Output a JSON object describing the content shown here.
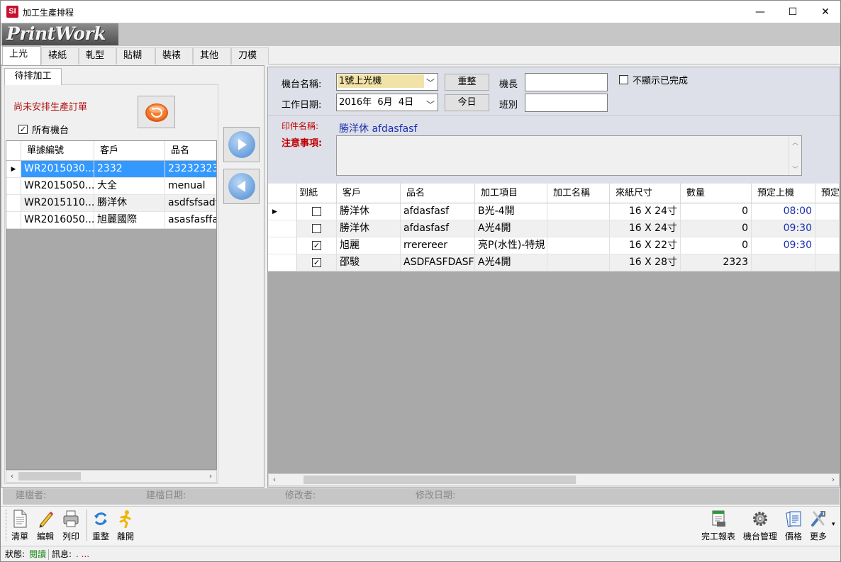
{
  "window": {
    "title": "加工生產排程",
    "app_icon": "SI",
    "minimize": "—",
    "maximize": "☐",
    "close": "✕",
    "logo": "PrintWork"
  },
  "tabs": [
    "上光",
    "裱紙",
    "軋型",
    "貼糊",
    "裝裱",
    "其他",
    "刀模"
  ],
  "left": {
    "subtab": "待排加工",
    "unscheduled_label": "尚未安排生產訂單",
    "all_machines_label": "所有機台",
    "all_machines_checked": true,
    "columns": [
      "單據編號",
      "客戶",
      "品名"
    ],
    "rows": [
      {
        "id": "WR2015030...",
        "customer": "2332",
        "product": "23232323",
        "selected": true
      },
      {
        "id": "WR2015050...",
        "customer": "大全",
        "product": "menual",
        "selected": false
      },
      {
        "id": "WR2015110...",
        "customer": "勝洋休",
        "product": "asdfsfsadf",
        "selected": false
      },
      {
        "id": "WR2016050...",
        "customer": "旭麗國際",
        "product": "asasfasffaf",
        "selected": false
      }
    ]
  },
  "form": {
    "machine_label": "機台名稱:",
    "machine_value": "1號上光機",
    "reset_button": "重整",
    "leader_label": "機長",
    "leader_value": "",
    "hide_done_label": "不顯示已完成",
    "hide_done_checked": false,
    "date_label": "工作日期:",
    "date_value": "2016年  6月  4日",
    "today_button": "今日",
    "shift_label": "班別",
    "shift_value": "",
    "print_name_label": "印件名稱:",
    "print_name_value": "勝洋休 afdasfasf",
    "notes_label": "注意事項:",
    "notes_value": ""
  },
  "grid": {
    "columns": [
      "到紙",
      "客戶",
      "品名",
      "加工項目",
      "加工名稱",
      "來紙尺寸",
      "數量",
      "預定上機",
      "預定"
    ],
    "rows": [
      {
        "arrived": false,
        "customer": "勝洋休",
        "product": "afdasfasf",
        "process": "B光-4開",
        "process_name": "",
        "size": "16 X 24寸",
        "qty": "0",
        "scheduled": "08:00",
        "current": true
      },
      {
        "arrived": false,
        "customer": "勝洋休",
        "product": "afdasfasf",
        "process": "A光4開",
        "process_name": "",
        "size": "16 X 24寸",
        "qty": "0",
        "scheduled": "09:30",
        "current": false
      },
      {
        "arrived": true,
        "customer": "旭麗",
        "product": "rrerereer",
        "process": "亮P(水性)-特規",
        "process_name": "",
        "size": "16 X 22寸",
        "qty": "0",
        "scheduled": "09:30",
        "current": false
      },
      {
        "arrived": true,
        "customer": "邵駿",
        "product": "ASDFASFDASF",
        "process": "A光4開",
        "process_name": "",
        "size": "16 X 28寸",
        "qty": "2323",
        "scheduled": "",
        "current": false
      }
    ]
  },
  "audit": {
    "created_by": "建檔者:",
    "created_date": "建檔日期:",
    "modified_by": "修改者:",
    "modified_date": "修改日期:"
  },
  "toolbar": {
    "list": "清單",
    "edit": "編輯",
    "print": "列印",
    "refresh": "重整",
    "exit": "離開",
    "completion_report": "完工報表",
    "machine_mgmt": "機台管理",
    "price": "價格",
    "more": "更多"
  },
  "status": {
    "state_label": "狀態:",
    "state_value": "閱讀",
    "message_label": "訊息:",
    "message_value": ". ..."
  },
  "colors": {
    "selected_row": "#3399ff",
    "highlight_field": "#f1e3a7",
    "red_label": "#c00000",
    "blue_text": "#1a2fb0",
    "status_green": "#1a8a1a"
  }
}
